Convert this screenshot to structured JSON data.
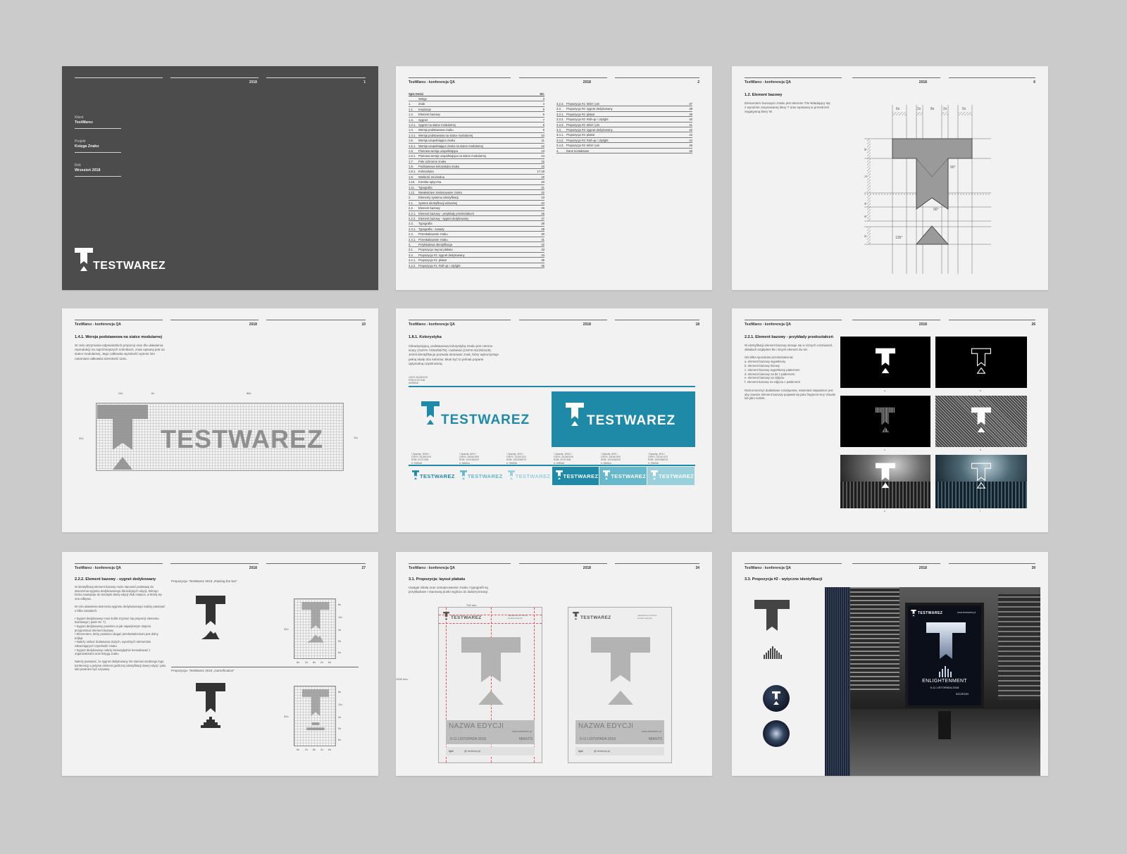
{
  "colors": {
    "background": "#cbcbcb",
    "page": "#f2f2f2",
    "cover": "#4c4c4c",
    "brand_teal": "#1e8aa8",
    "grey_mark": "#8f8f8f"
  },
  "cover": {
    "year": "2018",
    "page": "1",
    "client_label": "Klient",
    "client_value": "TestWarez",
    "project_label": "Projekt",
    "project_value": "Księga Znaku",
    "date_label": "Rok",
    "date_value": "Wrzesień 2018",
    "brand": "TESTWAREZ"
  },
  "toc_page": {
    "title": "TestWarez - konferencja QA",
    "year": "2018",
    "page": "2",
    "header_left": "Spis treści",
    "header_right": "Str.",
    "col1": [
      {
        "n": "",
        "l": "Wstęp",
        "p": "3"
      },
      {
        "n": "1.",
        "l": "Znak",
        "p": "4"
      },
      {
        "n": "1.1.",
        "l": "Inspiracje",
        "p": "5"
      },
      {
        "n": "1.2.",
        "l": "Element bazowy",
        "p": "6"
      },
      {
        "n": "1.3.",
        "l": "Sygnet",
        "p": "7"
      },
      {
        "n": "1.3.1.",
        "l": "Sygnet na siatce modularnej",
        "p": "8"
      },
      {
        "n": "1.4.",
        "l": "Wersja podstawowa znaku",
        "p": "9"
      },
      {
        "n": "1.4.1.",
        "l": "Wersja podstawowa na siatce modularnej",
        "p": "10"
      },
      {
        "n": "1.5.",
        "l": "Wersja uzupełniająca znaku",
        "p": "11"
      },
      {
        "n": "1.5.1.",
        "l": "Wersja uzupełniająca znaku na siatce modularnej",
        "p": "12"
      },
      {
        "n": "1.6.",
        "l": "Pionowa wersja uzupełniająca",
        "p": "13"
      },
      {
        "n": "1.6.1.",
        "l": "Pionowa wersja uzupełniająca na siatce modularnej",
        "p": "14"
      },
      {
        "n": "1.7.",
        "l": "Pole ochronne znaku",
        "p": "15"
      },
      {
        "n": "1.8.",
        "l": "Podstawowa kolorystyka znaku",
        "p": "16"
      },
      {
        "n": "1.8.1.",
        "l": "Kolorystyka",
        "p": "17-18"
      },
      {
        "n": "1.9.",
        "l": "Wielkość minimalna",
        "p": "19"
      },
      {
        "n": "1.10.",
        "l": "Korekta optyczna",
        "p": "20"
      },
      {
        "n": "1.11.",
        "l": "Typografia",
        "p": "21"
      },
      {
        "n": "1.12.",
        "l": "Niewłaściwe zastosowanie znaku",
        "p": "22"
      },
      {
        "n": "2.",
        "l": "Elementy systemu identyfikacji",
        "p": "23"
      },
      {
        "n": "2.1.",
        "l": "System identyfikacji wizualnej",
        "p": "24"
      },
      {
        "n": "2.2.",
        "l": "Element bazowy",
        "p": "25"
      },
      {
        "n": "2.2.1.",
        "l": "Element bazowy - przykłady przekształceń",
        "p": "26"
      },
      {
        "n": "2.2.2.",
        "l": "Element bazowy - sygnet dedykowany",
        "p": "27"
      },
      {
        "n": "2.3.",
        "l": "Typografia",
        "p": "28"
      },
      {
        "n": "2.3.1.",
        "l": "Typografia - zasady",
        "p": "29"
      },
      {
        "n": "2.4.",
        "l": "Przeskalowanie znaku",
        "p": "30"
      },
      {
        "n": "2.4.1.",
        "l": "Przeskalowanie znaku",
        "p": "31"
      },
      {
        "n": "3.",
        "l": "Przykładowa identyfikacja",
        "p": "32"
      },
      {
        "n": "3.1.",
        "l": "Propozycja: layout plakatu",
        "p": "33"
      },
      {
        "n": "3.2.",
        "l": "Propozycja #1: sygnet dedykowany",
        "p": "34"
      },
      {
        "n": "3.2.1.",
        "l": "Propozycja #1: plakat",
        "p": "35"
      },
      {
        "n": "3.2.2.",
        "l": "Propozycja #1: Roll-up / citylight",
        "p": "36"
      }
    ],
    "col2": [
      {
        "n": "3.2.3.",
        "l": "Propozycja #1: tshirt / pin",
        "p": "37"
      },
      {
        "n": "3.3.",
        "l": "Propozycja #2: sygnet dedykowany",
        "p": "38"
      },
      {
        "n": "3.3.1.",
        "l": "Propozycja #2: plakat",
        "p": "39"
      },
      {
        "n": "3.3.2.",
        "l": "Propozycja #2: Roll-up / citylight",
        "p": "40"
      },
      {
        "n": "3.3.3.",
        "l": "Propozycja #2: tshirt / pin",
        "p": "41"
      },
      {
        "n": "3.4.",
        "l": "Propozycja #3: sygnet dedykowany",
        "p": "42"
      },
      {
        "n": "3.4.1.",
        "l": "Propozycja #3: plakat",
        "p": "43"
      },
      {
        "n": "3.4.2.",
        "l": "Propozycja #3: Roll-up / citylight",
        "p": "44"
      },
      {
        "n": "3.4.3.",
        "l": "Propozycja #3: tshirt / pin",
        "p": "45"
      },
      {
        "n": "4.",
        "l": "Dane kontaktowe",
        "p": "46"
      }
    ]
  },
  "element_page": {
    "title": "TestWarez - konferencja QA",
    "year": "2018",
    "page": "6",
    "heading": "1.2. Element bazowy",
    "text": "Elementem bazowym znaku jest akronim TW składający się z wyraźnie zarysowanej litery T oraz wpisanej w przestrzeń negatywną litery W.",
    "dims_top": [
      "6x",
      "2x",
      "8x",
      "2x",
      "6x"
    ],
    "dims_left": [
      "8x",
      "11x",
      "4x",
      "5x",
      "6x"
    ],
    "angles": [
      "90°",
      "90°",
      "135°"
    ]
  },
  "grid_page": {
    "title": "TestWarez - konferencja QA",
    "year": "2018",
    "page": "10",
    "heading": "1.4.1. Wersja podstawowa na siatce modularnej",
    "text": "W celu utrzymania odpowiednich proporcji oraz dla ułatwienia reprodukcji na najróżniejszych nośnikach, znak opisany jest na siatce modularnej. Jego całkowita wysokość wynosi 32x natomiast całkowita szerokość 118x.",
    "dims": [
      "24x",
      "6x",
      "88x",
      "32x",
      "11x"
    ],
    "wordmark": "TESTWAREZ"
  },
  "color_page": {
    "title": "TestWarez - konferencja QA",
    "year": "2018",
    "page": "18",
    "heading": "1.8.1. Kolorystyka",
    "text": "Obowiązującą, podstawową kolorystyką znaku jest ciemno szary (CMYK-74/64/59/78) i niebieski (CMYK-81/26/31/8). Jeżeli identyfikacja pozwala stosować znak, który wykorzystuje pełną skalę obu kolorów. Musi być to jednak poparte optymalną czytelnością.",
    "spec": "CMYK 81/26/31/8\nRGB 0/137/166\n#0089A6",
    "wordmark": "TESTWAREZ",
    "tint_labels": [
      "/ Opacity: 100% /\nCMYK: 81/26/31/8\nRGB: 0/137/166\n#: 0089a6",
      "/ Opacity: 60% /\nCMYK: 48/16/19/5\nRGB: 102/184/202\n#: 66b8ca",
      "/ Opacity: 40% /\nCMYK: 32/10/12/3\nRGB: 153/208/219\n#: 99d0db",
      "/ Opacity: 100% /\nCMYK: 81/26/31/8\nRGB: 0/137/166\n#: 0089a6",
      "/ Opacity: 60% /\nCMYK: 48/16/19/5\nRGB: 102/184/202\n#: 66b8ca",
      "/ Opacity: 40% /\nCMYK: 32/10/12/3\nRGB: 153/208/219\n#: 99d0db"
    ]
  },
  "examples_page": {
    "title": "TestWarez - konferencja QA",
    "year": "2018",
    "page": "26",
    "heading": "2.2.1. Element bazowy - przykłady przekształceń",
    "text": "W identyfikacji element bazowy stosuje się w różnych rozmiarach, układach względem tła i innych element ów etc.\n\nOto kilka sposobów przekształcenia:\na. element bazowy wypełniony\nb. element bazowy liniowy\nc. element bazowy wypełniony patternem\nd. element bazowy na tle z patternem\ne. element bazowy na zdjęciu\nf. element bazowy na zdjęciu z patternem\n\nMożna tworzyć dodatkowe rozwiązania, natomiast największe jest aby zawsze element bazowy pojawiał się jako fragment Key Visuals lub jako nośnik.",
    "captions": [
      "a",
      "b",
      "c",
      "d",
      "e",
      "f"
    ]
  },
  "sygnet_page": {
    "title": "TestWarez - konferencja QA",
    "year": "2018",
    "page": "27",
    "heading": "2.2.2. Element bazowy - sygnet dedykowany",
    "text": "W identyfikacji element bazowy może stanowić podstawę do stworzenia sygnetu dedykowanego dla kolejnych edycji, którego forma nawiązuje do tematyki danej edycji i/lub miejsca, w której się ona odbywa.\n\nW celu ułatwienia tworzenia sygnetu dedykowanego należy pamiętać o kilku zasadach:\n\n• Sygnet dedykowany musi ściśle trzymać się proporcji elementu bazowego ( patrz str. 7)\n• Sygnet dedykowany powinien w jak największym stopniu przypominać element bazowy\n• Elementem, który powinien ulegać przekształceniom jest dolny trójkąt\n• Należy unikać dodawania dużych, wyraźnych elementów zaburzających czytelność znaku\n• Sygnet dedykowany należy bezwzględnie konsultować z organizatorami oraz księgą znaku\n\nNależy pamiętać, że sygnet dedykowany nie stanowi osobnego logo konferencji a jedynie element graficzny identyfikacji danej edycji i jako taki powinien być używany.",
    "proposal1": "Propozycja- TestWarez 2018 „Raising the bar”",
    "proposal2": "Propozycja- TestWarez 2019 „Gamefication”",
    "dims_h": [
      "6x",
      "2x",
      "8x",
      "2x",
      "6x"
    ],
    "dims_v": [
      "8x",
      "11x",
      "4x",
      "5x",
      "6x"
    ],
    "dim_total": "32x"
  },
  "poster_page": {
    "title": "TestWarez - konferencja QA",
    "year": "2018",
    "page": "34",
    "heading": "3.1. Propozycja: layout plakatu",
    "text": "Uwaga! Skala oraz umiejscowienie znaku i typografii są przykładowe i stanowią punkt wyjścia do dalszej kreacji.",
    "width_label": "700 mm",
    "height_label": "1000 mm",
    "brand": "TESTWAREZ",
    "subtitle": "największa w Polsce konferencja QA",
    "edition": "NAZWA EDYCJI",
    "url": "www.testwarez.pl",
    "date": "9-11 LISTOPADA 2018",
    "city": "MIASTO",
    "sponsor": "sjsi",
    "partner": "@ testerzy.pl"
  },
  "proposal_page": {
    "title": "TestWarez - konferencja QA",
    "year": "2018",
    "page": "39",
    "heading": "3.3. Propozycja #2 - wytyczne identyfikacji",
    "poster_brand": "TESTWAREZ",
    "poster_title": "ENLIGHTENMENT",
    "poster_date": "9-11 LISTOPADA 2018",
    "poster_city": "SZCZECIN",
    "poster_url": "www.testwarez.pl"
  }
}
